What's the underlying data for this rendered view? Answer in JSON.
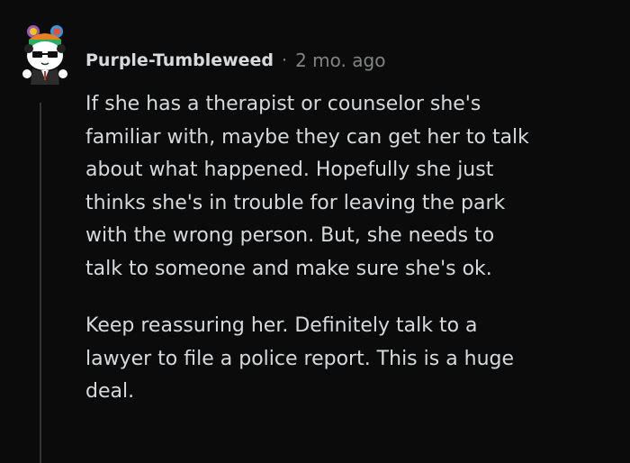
{
  "comment": {
    "username": "Purple-Tumbleweed",
    "separator": "·",
    "timestamp": "2 mo. ago",
    "paragraphs": [
      "If she has a therapist or counselor she's\nfamiliar with, maybe they can get her to talk\nabout what happened. Hopefully she just\nthinks she's in trouble for leaving the park\nwith the wrong person. But, she needs to\ntalk to someone and make sure she's ok.",
      "Keep reassuring her. Definitely talk to a\nlawyer to file a police report. This is a huge\ndeal."
    ]
  },
  "colors": {
    "background": "#0b0b0b",
    "text": "#d7dadc",
    "meta": "#818384",
    "thread_line": "#343536"
  },
  "icons": {
    "avatar": "snoo-panda-avatar-icon"
  }
}
